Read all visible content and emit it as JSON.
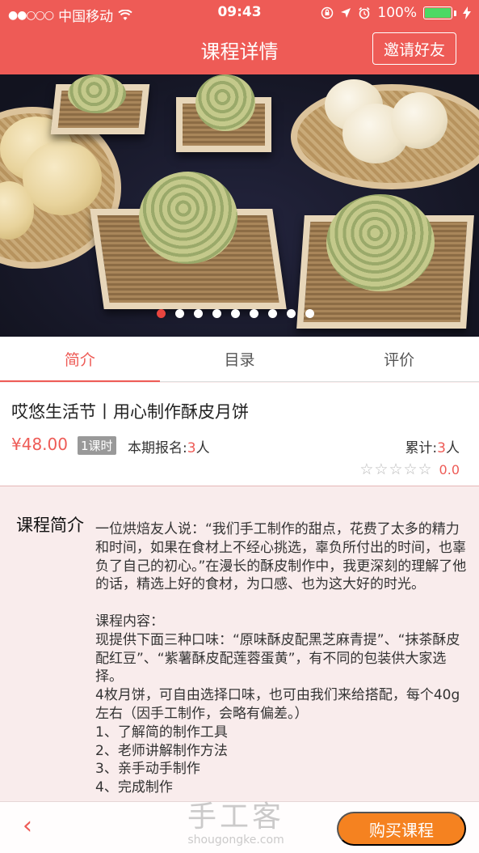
{
  "status_bar": {
    "signal": "●●○○○",
    "carrier": "中国移动",
    "time": "09:43",
    "battery": "100%"
  },
  "header": {
    "title": "课程详情",
    "invite_label": "邀请好友"
  },
  "carousel": {
    "total_slides": 9,
    "active_index": 0
  },
  "tabs": [
    {
      "label": "简介",
      "active": true
    },
    {
      "label": "目录",
      "active": false
    },
    {
      "label": "评价",
      "active": false
    }
  ],
  "course": {
    "name": "哎悠生活节丨用心制作酥皮月饼",
    "price": "¥48.00",
    "lessons_badge": "1课时",
    "enrolled_prefix": "本期报名:",
    "enrolled_count": "3",
    "enrolled_suffix": "人",
    "total_prefix": "累计:",
    "total_count": "3",
    "total_suffix": "人",
    "stars": "☆☆☆☆☆",
    "rating": "0.0"
  },
  "intro": {
    "label": "课程简介",
    "text": "一位烘焙友人说：“我们手工制作的甜点，花费了太多的精力和时间，如果在食材上不经心挑选，辜负所付出的时间，也辜负了自己的初心。”在漫长的酥皮制作中，我更深刻的理解了他的话，精选上好的食材，为口感、也为这大好的时光。\n\n课程内容：\n现提供下面三种口味：“原味酥皮配黑芝麻青提”、“抹茶酥皮配红豆”、“紫薯酥皮配莲蓉蛋黄”，有不同的包装供大家选择。\n4枚月饼，可自由选择口味，也可由我们来给搭配，每个40g左右（因手工制作，会略有偏差。）\n1、了解简的制作工具\n2、老师讲解制作方法\n3、亲手动手制作\n4、完成制作"
  },
  "bottom_bar": {
    "back_icon": "‹",
    "buy_label": "购买课程"
  },
  "watermark": {
    "logo": "手工客",
    "url": "shougongke.com"
  },
  "colors": {
    "brand_red": "#ee5b56",
    "buy_orange": "#f58220",
    "intro_bg": "#f9ecec"
  }
}
